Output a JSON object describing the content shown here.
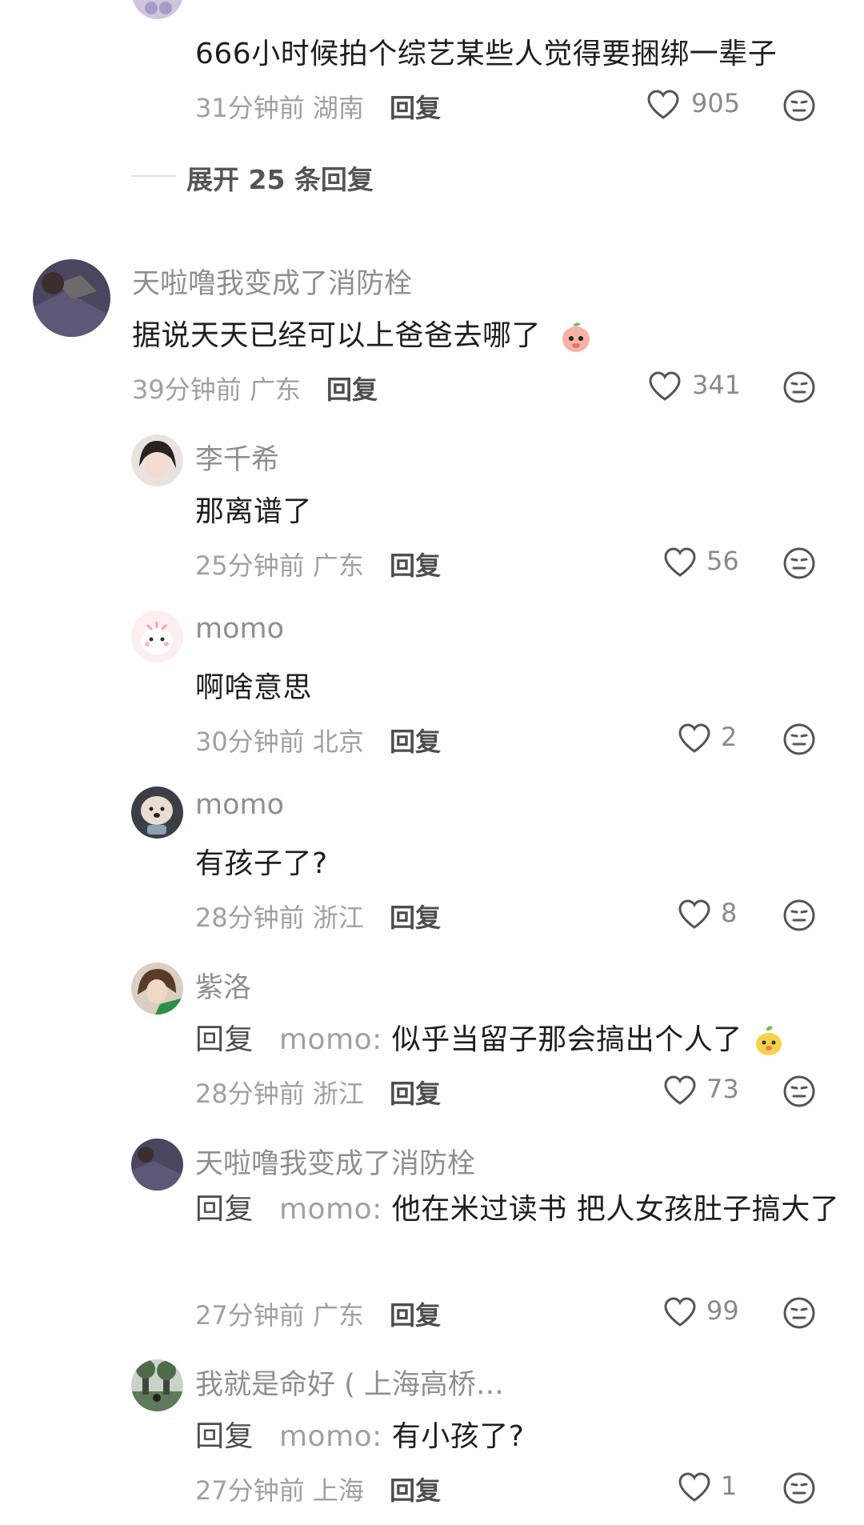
{
  "top_comment": {
    "text": "666小时候拍个综艺某些人觉得要捆绑一辈子",
    "meta": "31分钟前 湖南",
    "reply": "回复",
    "likes": "905"
  },
  "expand": {
    "label": "展开 25 条回复"
  },
  "main_comment": {
    "username": "天啦噜我变成了消防栓",
    "text": "据说天天已经可以上爸爸去哪了",
    "meta": "39分钟前 广东",
    "reply": "回复",
    "likes": "341"
  },
  "replies": [
    {
      "username": "李千希",
      "text": "那离谱了",
      "meta": "25分钟前 广东",
      "reply": "回复",
      "likes": "56"
    },
    {
      "username": "momo",
      "text": "啊啥意思",
      "meta": "30分钟前 北京",
      "reply": "回复",
      "likes": "2"
    },
    {
      "username": "momo",
      "text": "有孩子了?",
      "meta": "28分钟前 浙江",
      "reply": "回复",
      "likes": "8"
    },
    {
      "username": "紫洛",
      "prefix": "回复",
      "mention": "momo:",
      "text": "似乎当留子那会搞出个人了",
      "meta": "28分钟前 浙江",
      "reply": "回复",
      "likes": "73"
    },
    {
      "username": "天啦噜我变成了消防栓",
      "prefix": "回复",
      "mention": "momo:",
      "text": "他在米过读书 把人女孩肚子搞大了",
      "meta": "27分钟前 广东",
      "reply": "回复",
      "likes": "99"
    },
    {
      "username": "我就是命好 ( 上海高桥…",
      "prefix": "回复",
      "mention": "momo:",
      "text": "有小孩了?",
      "meta": "27分钟前 上海",
      "reply": "回复",
      "likes": "1"
    }
  ],
  "colors": {
    "background": "#ffffff",
    "meta": "#a0a0a0",
    "name": "#8f8f8f",
    "text": "#1e1e1e"
  },
  "icons": {
    "like": "heart-icon",
    "dislike": "dislike-face-icon"
  }
}
